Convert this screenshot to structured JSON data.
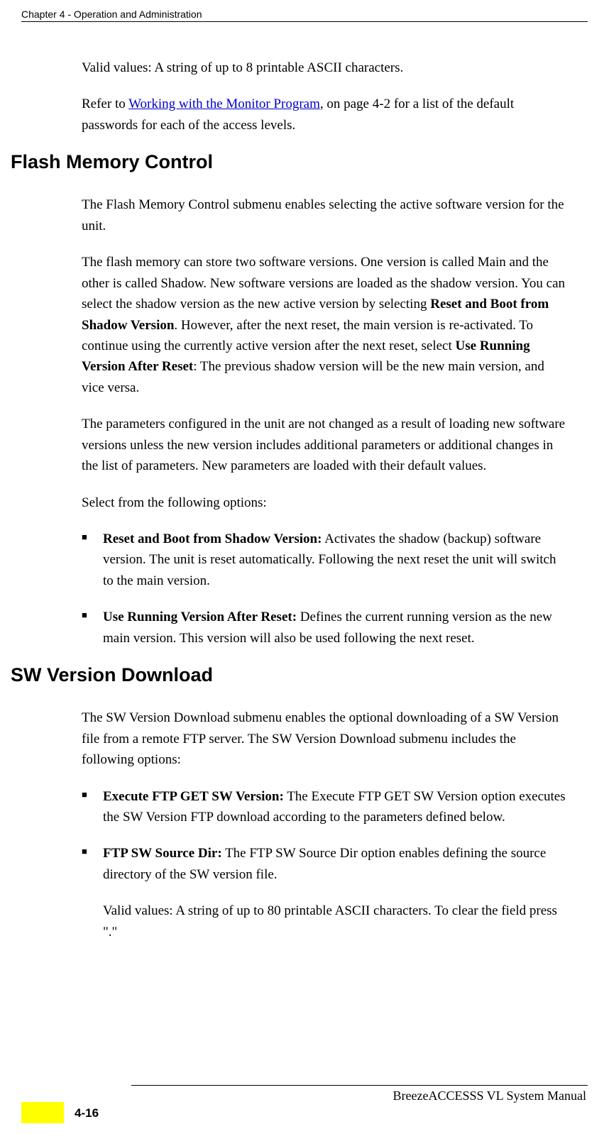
{
  "header": {
    "title": "Chapter 4 - Operation and Administration"
  },
  "content": {
    "para1": "Valid values: A string of up to 8 printable ASCII characters.",
    "para2_pre": "Refer to ",
    "para2_link": "Working with the Monitor Program",
    "para2_post": ", on page 4-2 for a list of the default passwords for each of the access levels.",
    "h_flash": "Flash Memory Control",
    "flash_para1": "The Flash Memory Control submenu enables selecting the active software version for the unit.",
    "flash_para2_a": "The flash memory can store two software versions. One version is called Main and the other is called Shadow. New software versions are loaded as the shadow version. You can select the shadow version as the new active version by selecting ",
    "flash_para2_bold1": "Reset and Boot from Shadow Version",
    "flash_para2_b": ". However, after the next reset, the main version is re-activated. To continue using the currently active version after the next reset, select ",
    "flash_para2_bold2": "Use Running Version After Reset",
    "flash_para2_c": ": The previous shadow version will be the new main version, and vice versa.",
    "flash_para3": "The parameters configured in the unit are not changed as a result of loading new software versions unless the new version includes additional parameters or additional changes in the list of parameters. New parameters are loaded with their default values.",
    "flash_para4": "Select from the following options:",
    "flash_bullet1_bold": "Reset and Boot from Shadow Version:",
    "flash_bullet1_text": " Activates the shadow (backup) software version. The unit is reset automatically. Following the next reset the unit will switch to the main version.",
    "flash_bullet2_bold": "Use Running Version After Reset:",
    "flash_bullet2_text": " Defines the current running version as the new main version. This version will also be used following the next reset.",
    "h_sw": "SW Version Download",
    "sw_para1": "The SW Version Download submenu enables the optional downloading of a SW Version file from a remote FTP server. The SW Version Download submenu includes the following options:",
    "sw_bullet1_bold": "Execute FTP GET SW Version:",
    "sw_bullet1_text": " The Execute FTP GET SW Version option executes the SW Version FTP download according to the parameters defined below.",
    "sw_bullet2_bold": "FTP SW Source Dir:",
    "sw_bullet2_text": " The FTP SW Source Dir option enables defining the source directory of the SW version file.",
    "sw_sub_para": "Valid values: A string of up to 80 printable ASCII characters. To clear the field press \".\""
  },
  "footer": {
    "right": "BreezeACCESSS VL System Manual",
    "left": "4-16"
  }
}
